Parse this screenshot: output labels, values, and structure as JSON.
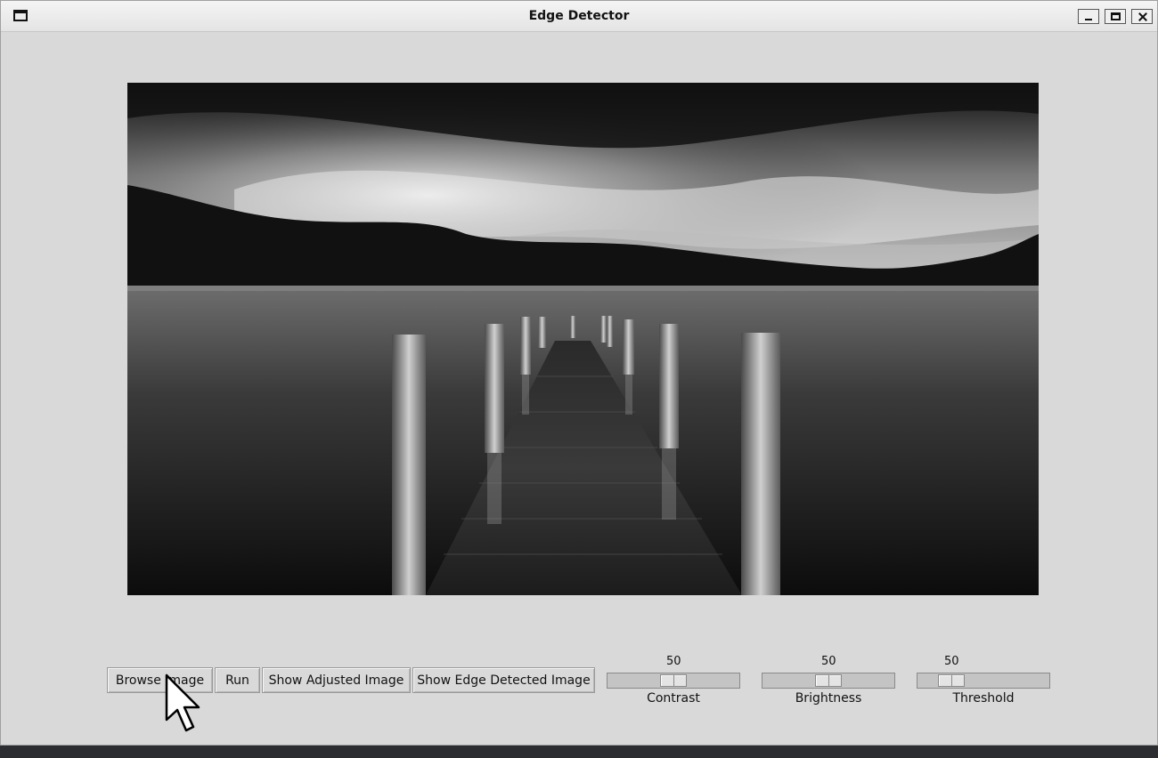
{
  "window": {
    "title": "Edge Detector"
  },
  "image": {
    "description_icon": "pier-landscape-image"
  },
  "toolbar": {
    "browse_label": "Browse Image",
    "run_label": "Run",
    "show_adjusted_label": "Show Adjusted Image",
    "show_edge_label": "Show Edge Detected Image"
  },
  "sliders": {
    "contrast": {
      "label": "Contrast",
      "value": "50",
      "fraction": 0.5
    },
    "brightness": {
      "label": "Brightness",
      "value": "50",
      "fraction": 0.5
    },
    "threshold": {
      "label": "Threshold",
      "value": "50",
      "fraction": 0.2
    }
  },
  "colors": {
    "window_bg": "#d9d9d9",
    "trough": "#c4c4c4"
  }
}
